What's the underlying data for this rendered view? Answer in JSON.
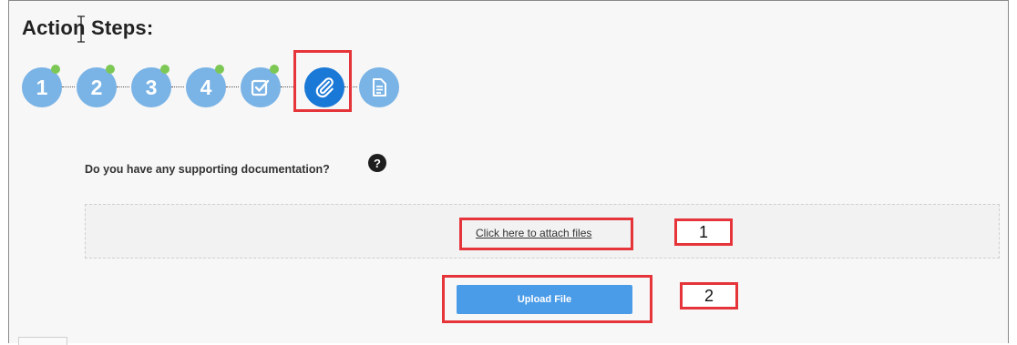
{
  "header": {
    "title": "Action Steps:"
  },
  "steps": [
    {
      "label": "1",
      "type": "number",
      "completed": true
    },
    {
      "label": "2",
      "type": "number",
      "completed": true
    },
    {
      "label": "3",
      "type": "number",
      "completed": true
    },
    {
      "label": "4",
      "type": "number",
      "completed": true
    },
    {
      "label": "",
      "icon": "checkbox-icon",
      "completed": true
    },
    {
      "label": "",
      "icon": "paperclip-icon",
      "active": true
    },
    {
      "label": "",
      "icon": "document-icon"
    }
  ],
  "attachments": {
    "question": "Do you have any supporting documentation?",
    "help_icon": "?",
    "attach_link": "Click here to attach files",
    "upload_button": "Upload File"
  },
  "callouts": {
    "one": "1",
    "two": "2"
  },
  "colors": {
    "step": "#7ab3e5",
    "step_active": "#1a78d6",
    "completed_dot": "#7dc855",
    "highlight": "#e5343a",
    "upload_button": "#4a9be8"
  }
}
